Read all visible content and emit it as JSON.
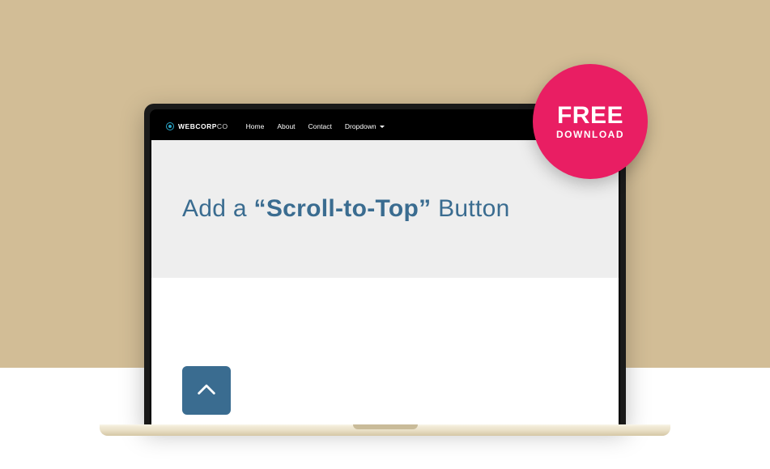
{
  "brand": {
    "strong": "WEBCORP",
    "light": "CO"
  },
  "nav": {
    "home": "Home",
    "about": "About",
    "contact": "Contact",
    "dropdown": "Dropdown"
  },
  "hero": {
    "pre": "Add a ",
    "quoted": "“Scroll-to-Top”",
    "post": " Button"
  },
  "scroll_top": {
    "name": "scroll-to-top-button"
  },
  "badge": {
    "line1": "FREE",
    "line2": "DOWNLOAD"
  },
  "colors": {
    "accent": "#3a6c90",
    "badge": "#e91e63",
    "sand": "#d2bd96"
  }
}
